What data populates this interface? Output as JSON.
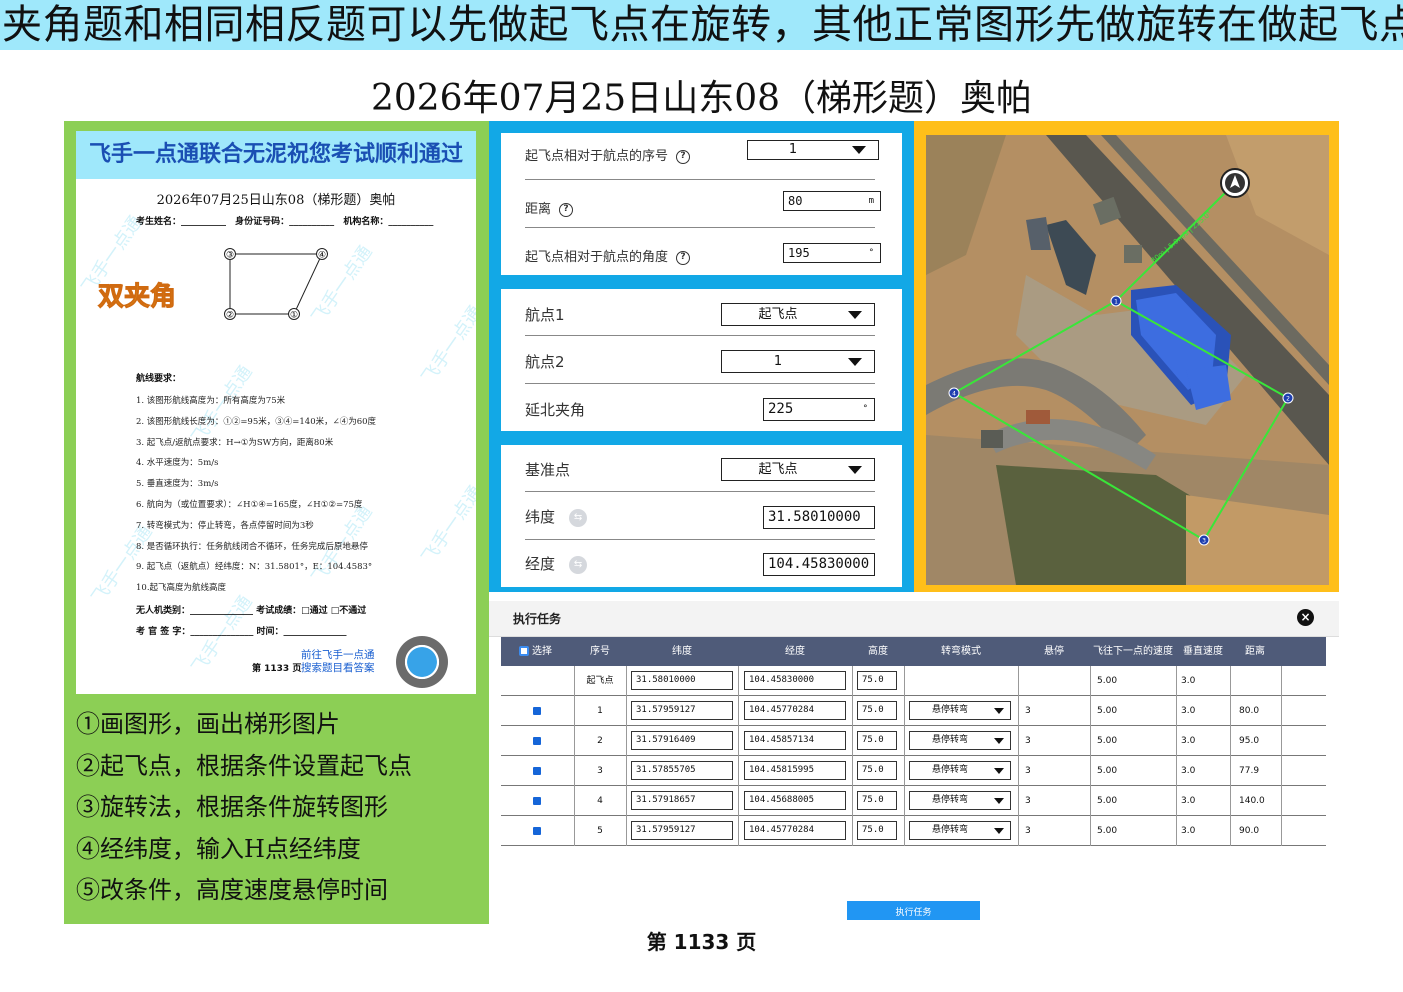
{
  "banner": "夹角题和相同相反题可以先做起飞点在旋转，其他正常图形先做旋转在做起飞点",
  "page_title": "2026年07月25日山东08（梯形题）奥帕",
  "paper": {
    "banner": "飞手一点通联合无泥祝您考试顺利通过",
    "title": "2026年07月25日山东08（梯形题）奥帕",
    "field_name": "考生姓名：__________",
    "field_id": "身份证号码：__________",
    "field_org": "机构名称：__________",
    "tag": "双夹角",
    "watermark": "飞手一点通",
    "shape_labels": [
      "③",
      "④",
      "②",
      "①"
    ],
    "req_title": "航线要求：",
    "requirements": [
      "1. 该图形航线高度为：所有高度为75米",
      "2. 该图形航线长度为：①②=95米，③④=140米，∠④为60度",
      "3. 起飞点/返航点要求：H→①为SW方向，距离80米",
      "4. 水平速度为：5m/s",
      "5. 垂直速度为：3m/s",
      "6. 航向为（或位置要求）：∠H①④=165度，∠H①②=75度",
      "7. 转弯模式为：停止转弯，各点停留时间为3秒",
      "8. 是否循环执行：任务航线闭合不循环，任务完成后原地悬停",
      "9. 起飞点（返航点）经纬度：N：31.5801°，E：104.4583°",
      "10.起飞高度为航线高度"
    ],
    "sign_line1": "无人机类别：______________  考试成绩：□通过  □不通过",
    "sign_line2": "考 官 签 字：______________  时间：______________",
    "footer": "第 1133 页",
    "promo_line1": "前往飞手一点通",
    "promo_line2": "搜索题目看答案"
  },
  "steps": [
    "①画图形，画出梯形图片",
    "②起飞点，根据条件设置起飞点",
    "③旋转法，根据条件旋转图形",
    "④经纬度，输入H点经纬度",
    "⑤改条件，高度速度悬停时间"
  ],
  "settings": {
    "takeoff_seq_label": "起飞点相对于航点的序号",
    "takeoff_seq_value": "1",
    "distance_label": "距离",
    "distance_value": "80",
    "distance_unit": "m",
    "angle_label": "起飞点相对于航点的角度",
    "angle_value": "195",
    "angle_unit": "°",
    "wp1_label": "航点1",
    "wp1_value": "起飞点",
    "wp2_label": "航点2",
    "wp2_value": "1",
    "north_angle_label": "延北夹角",
    "north_angle_value": "225",
    "north_angle_unit": "°",
    "base_label": "基准点",
    "base_value": "起飞点",
    "lat_label": "纬度",
    "lat_value": "31.58010000",
    "lon_label": "经度",
    "lon_value": "104.45830000"
  },
  "map": {
    "waypoint_labels": [
      "1",
      "2",
      "3",
      "4"
    ]
  },
  "task": {
    "title": "执行任务",
    "close_icon": "×",
    "headers": [
      "选择",
      "序号",
      "纬度",
      "经度",
      "高度",
      "转弯模式",
      "悬停",
      "飞往下一点的速度",
      "垂直速度",
      "距离"
    ],
    "rows": [
      {
        "seq": "起飞点",
        "lat": "31.58010000",
        "lon": "104.45830000",
        "alt": "75.0",
        "turn": "",
        "hover": "",
        "speed": "5.00",
        "vspeed": "3.0",
        "dist": ""
      },
      {
        "seq": "1",
        "lat": "31.57959127",
        "lon": "104.45770284",
        "alt": "75.0",
        "turn": "悬停转弯",
        "hover": "3",
        "speed": "5.00",
        "vspeed": "3.0",
        "dist": "80.0"
      },
      {
        "seq": "2",
        "lat": "31.57916409",
        "lon": "104.45857134",
        "alt": "75.0",
        "turn": "悬停转弯",
        "hover": "3",
        "speed": "5.00",
        "vspeed": "3.0",
        "dist": "95.0"
      },
      {
        "seq": "3",
        "lat": "31.57855705",
        "lon": "104.45815995",
        "alt": "75.0",
        "turn": "悬停转弯",
        "hover": "3",
        "speed": "5.00",
        "vspeed": "3.0",
        "dist": "77.9"
      },
      {
        "seq": "4",
        "lat": "31.57918657",
        "lon": "104.45688005",
        "alt": "75.0",
        "turn": "悬停转弯",
        "hover": "3",
        "speed": "5.00",
        "vspeed": "3.0",
        "dist": "140.0"
      },
      {
        "seq": "5",
        "lat": "31.57959127",
        "lon": "104.45770284",
        "alt": "75.0",
        "turn": "悬停转弯",
        "hover": "3",
        "speed": "5.00",
        "vspeed": "3.0",
        "dist": "90.0"
      }
    ],
    "exec_button": "执行任务"
  },
  "page_number": "第 1133 页",
  "colors": {
    "banner": "#9fe8fb",
    "left_panel": "#8ccf55",
    "settings_panel": "#12a8e6",
    "map_panel": "#ffbf1a",
    "table_header": "#4f5b79",
    "route_line": "#39e639",
    "accent": "#1565d8"
  }
}
